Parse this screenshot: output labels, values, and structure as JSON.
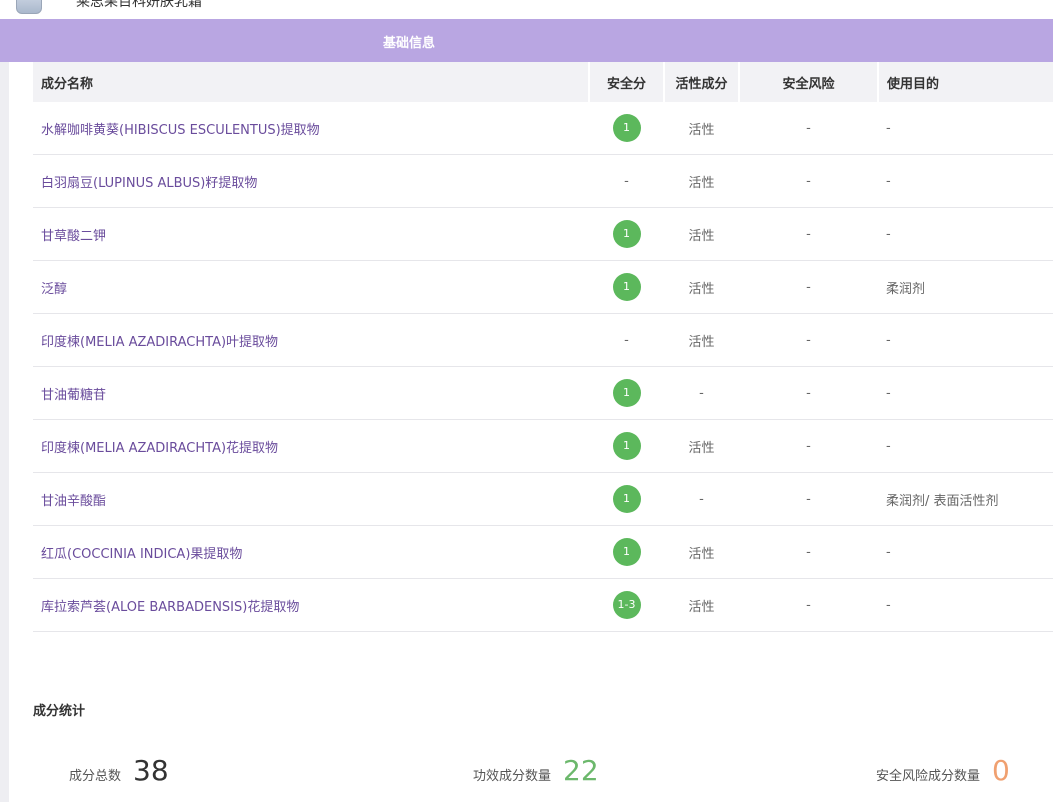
{
  "header": {
    "title": "莱思果百科妍肤乳霜",
    "section": "基础信息"
  },
  "table": {
    "columns": [
      "成分名称",
      "安全分",
      "活性成分",
      "安全风险",
      "使用目的"
    ],
    "rows": [
      {
        "name": "水解咖啡黄葵(HIBISCUS ESCULENTUS)提取物",
        "score": "1",
        "active": "活性",
        "risk": "-",
        "purpose": "-"
      },
      {
        "name": "白羽扇豆(LUPINUS ALBUS)籽提取物",
        "score": "-",
        "active": "活性",
        "risk": "-",
        "purpose": "-"
      },
      {
        "name": "甘草酸二钾",
        "score": "1",
        "active": "活性",
        "risk": "-",
        "purpose": "-"
      },
      {
        "name": "泛醇",
        "score": "1",
        "active": "活性",
        "risk": "-",
        "purpose": "柔润剂"
      },
      {
        "name": "印度楝(MELIA AZADIRACHTA)叶提取物",
        "score": "-",
        "active": "活性",
        "risk": "-",
        "purpose": "-"
      },
      {
        "name": "甘油葡糖苷",
        "score": "1",
        "active": "-",
        "risk": "-",
        "purpose": "-"
      },
      {
        "name": "印度楝(MELIA AZADIRACHTA)花提取物",
        "score": "1",
        "active": "活性",
        "risk": "-",
        "purpose": "-"
      },
      {
        "name": "甘油辛酸酯",
        "score": "1",
        "active": "-",
        "risk": "-",
        "purpose": "柔润剂/ 表面活性剂"
      },
      {
        "name": "红瓜(COCCINIA INDICA)果提取物",
        "score": "1",
        "active": "活性",
        "risk": "-",
        "purpose": "-"
      },
      {
        "name": "库拉索芦荟(ALOE BARBADENSIS)花提取物",
        "score": "1-3",
        "active": "活性",
        "risk": "-",
        "purpose": "-"
      }
    ]
  },
  "stats": {
    "title": "成分统计",
    "total_label": "成分总数",
    "total_value": "38",
    "effect_label": "功效成分数量",
    "effect_value": "22",
    "risk_label": "安全风险成分数量",
    "risk_value": "0"
  },
  "colors": {
    "banner": "#b9a6e2",
    "ingredient_link": "#6a4c9c",
    "score_badge": "#5cb85c",
    "total_value": "#333333",
    "effect_value": "#6cb86c",
    "risk_value": "#f0a070"
  },
  "icons": {
    "app_icon": "product-jar-icon"
  }
}
